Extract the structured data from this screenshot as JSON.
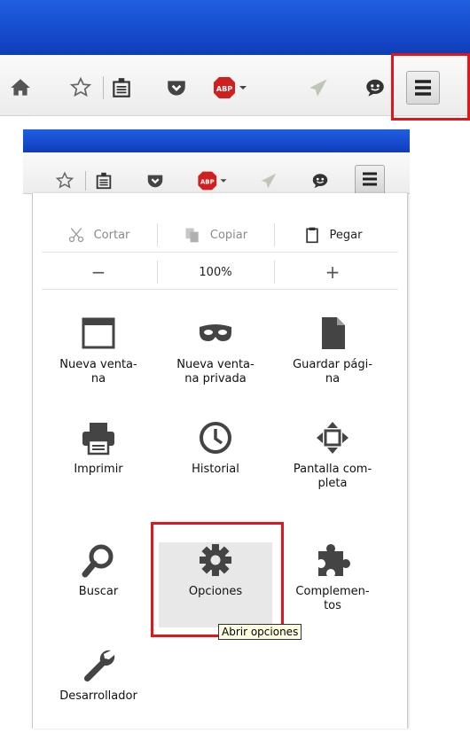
{
  "edit": {
    "cut": "Cortar",
    "copy": "Copiar",
    "paste": "Pegar"
  },
  "zoom": {
    "out": "−",
    "level": "100%",
    "in": "+"
  },
  "tiles": [
    {
      "label": "Nueva venta-\nna",
      "icon": "window-icon"
    },
    {
      "label": "Nueva venta-\nna privada",
      "icon": "mask-icon"
    },
    {
      "label": "Guardar pági-\nna",
      "icon": "page-icon"
    },
    {
      "label": "Imprimir",
      "icon": "printer-icon"
    },
    {
      "label": "Historial",
      "icon": "clock-icon"
    },
    {
      "label": "Pantalla com-\npleta",
      "icon": "fullscreen-icon"
    },
    {
      "label": "Buscar",
      "icon": "search-icon"
    },
    {
      "label": "Opciones",
      "icon": "gear-icon"
    },
    {
      "label": "Complemen-\ntos",
      "icon": "puzzle-icon"
    },
    {
      "label": "Desarrollador",
      "icon": "wrench-icon"
    }
  ],
  "tooltip": "Abrir opciones",
  "toolbar_icons": [
    "home-icon",
    "bookmark-star-icon",
    "reading-list-icon",
    "pocket-icon",
    "adblock-plus-icon",
    "share-icon",
    "chat-icon",
    "menu-icon"
  ],
  "adblock_badge": "ABP",
  "colors": {
    "highlight": "#e0161b",
    "titlebar": "#1447c8",
    "tooltip_bg": "#ffffe1"
  }
}
